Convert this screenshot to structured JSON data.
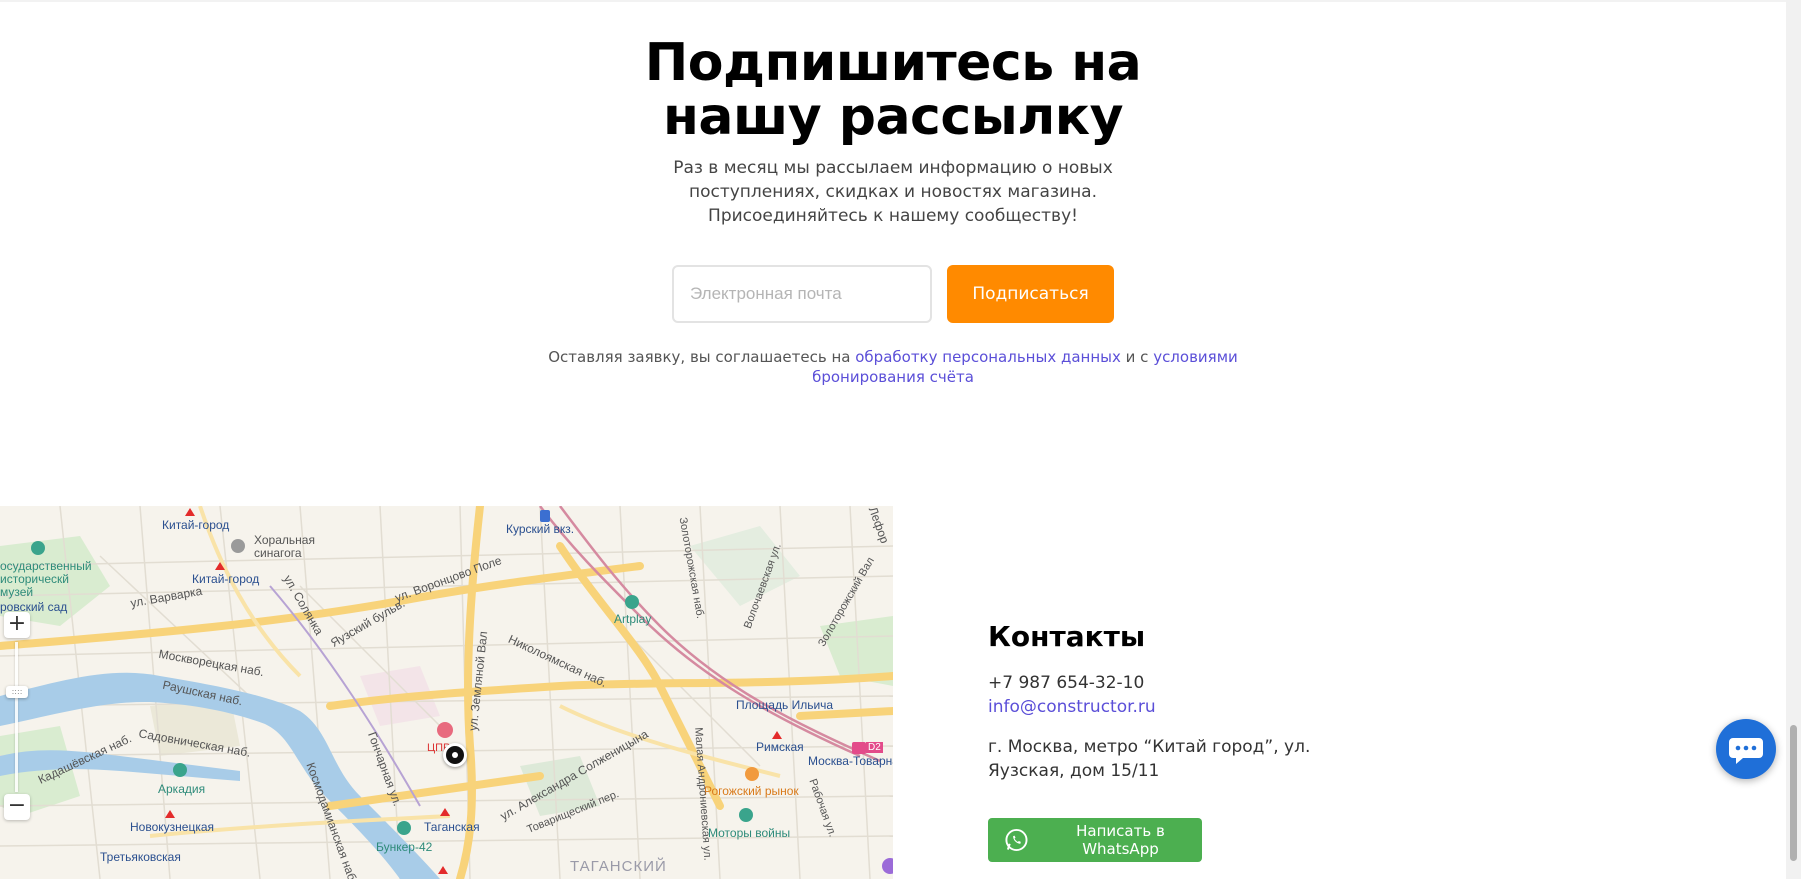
{
  "newsletter": {
    "title": "Подпишитесь на нашу рассылку",
    "description": "Раз в месяц мы рассылаем информацию о новых поступлениях, скидках и новостях магазина. Присоединяйтесь к нашему сообществу!",
    "email_placeholder": "Электронная почта",
    "subscribe_label": "Подписаться",
    "consent_prefix": "Оставляя заявку, вы соглашаетесь на ",
    "consent_link1": "обработку персональных данных",
    "consent_middle": " и с ",
    "consent_link2": "условиями бронирования счёта"
  },
  "map": {
    "labels": {
      "kitay_gorod_top": "Китай-город",
      "choral_synagogue": "Хоральная синагога",
      "kitay_gorod": "Китай-город",
      "state_museum": "осударственный историческй музей",
      "garden": "ровский сад",
      "varvarka": "ул. Варварка",
      "solyanka": "ул. Солянка",
      "vorontsovo": "ул. Воронцово Поле",
      "yauzsky": "Яузский бульв.",
      "kursky": "Курский вкз.",
      "artplay": "Artplay",
      "zemlyanoy": "ул. Земляной Вал",
      "nikoloyamskaya": "Николоямская наб.",
      "moskvoretskaya": "Москворецкая наб.",
      "raushskaya": "Раушская наб.",
      "sadovnicheskaya": "Садовническая наб.",
      "kadashevskaya": "Кадашёвская наб.",
      "arkadia": "Аркадия",
      "novokuznetskaya": "Новокузнецкая",
      "tretyakovskaya": "Третьяковская",
      "goncharnaya": "Гончарная ул.",
      "kosmodamianskaya": "Космодамианская наб.",
      "taganskaya": "Таганская",
      "bunker": "Бункер-42",
      "solzhenitsyna": "ул. Александра Солженицына",
      "tovarishchesky": "Товарищеский пер.",
      "taganskiy": "ТАГАНСКИЙ",
      "ilyicha": "Площадь Ильича",
      "rimskaya": "Римская",
      "moskva_tovarnaya": "Москва-Товарная",
      "rogozhsky": "Рогожский рынок",
      "motory": "Моторы войны",
      "malaya_andronievskaya": "Малая Андрониевская ул.",
      "rabochaya": "Рабочая ул.",
      "zolotorozhsky": "Золоторожский Вал",
      "zolotorozhskaya": "Золоторожская наб.",
      "volochaevskaya": "Волочаевская ул.",
      "lefortovo": "Лефор",
      "tsprn": "ЦПРН",
      "d2": "D2"
    },
    "zoom_in": "+",
    "zoom_out": "−"
  },
  "contacts": {
    "title": "Контакты",
    "phone": "+7 987 654-32-10",
    "email": "info@constructor.ru",
    "address": "г. Москва, метро “Китай город”, ул. Яузская, дом 15/11",
    "whatsapp_label": "Написать в WhatsApp"
  },
  "colors": {
    "accent_orange": "#ff8a00",
    "link_purple": "#5b4fd8",
    "whatsapp_green": "#4caf50",
    "chat_blue": "#1f6fd8"
  }
}
